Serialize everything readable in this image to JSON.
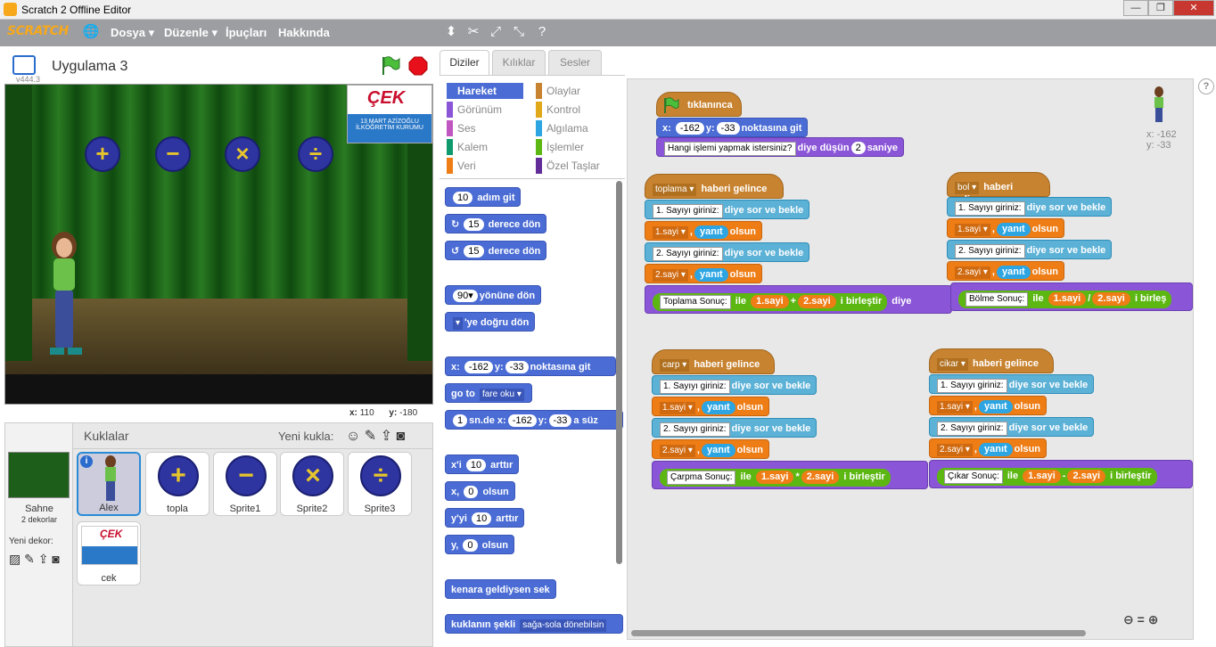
{
  "window": {
    "title": "Scratch 2 Offline Editor"
  },
  "menu": {
    "logo": "SCRATCH",
    "items": [
      "Dosya ▾",
      "Düzenle ▾",
      "İpuçları",
      "Hakkında"
    ]
  },
  "stage": {
    "project_name": "Uygulama 3",
    "version": "v444.3",
    "coords": {
      "x_label": "x:",
      "x_value": "110",
      "y_label": "y:",
      "y_value": "-180"
    },
    "logo_caption": "13 MART AZİZOĞLU\nİLKÖĞRETİM KURUMU"
  },
  "tabs": [
    "Diziler",
    "Kılıklar",
    "Sesler"
  ],
  "categories": {
    "left": [
      "Hareket",
      "Görünüm",
      "Ses",
      "Kalem",
      "Veri"
    ],
    "right": [
      "Olaylar",
      "Kontrol",
      "Algılama",
      "İşlemler",
      "Özel Taşlar"
    ],
    "colors_left": [
      "#4a6cd4",
      "#8a55d7",
      "#c057c0",
      "#0e9a6c",
      "#ee7d16"
    ],
    "colors_right": [
      "#c88330",
      "#e1a91a",
      "#2ca5e2",
      "#5cb712",
      "#632d99"
    ]
  },
  "palette": {
    "b1": {
      "val": "10",
      "txt": "adım git"
    },
    "b2": {
      "val": "15",
      "txt": "derece dön"
    },
    "b3": {
      "val": "15",
      "txt": "derece dön"
    },
    "b4": {
      "val": "90▾",
      "txt": "yönüne dön"
    },
    "b5": {
      "val": "▾",
      "txt": "'ye doğru dön"
    },
    "b6": {
      "x": "x:",
      "xv": "-162",
      "y": "y:",
      "yv": "-33",
      "txt": "noktasına git"
    },
    "b7": {
      "a": "go to",
      "v": "fare oku ▾"
    },
    "b8": {
      "v1": "1",
      "a": "sn.de x:",
      "v2": "-162",
      "b": "y:",
      "v3": "-33",
      "c": "a süz"
    },
    "b9": {
      "a": "x'i",
      "v": "10",
      "b": "arttır"
    },
    "b10": {
      "a": "x,",
      "v": "0",
      "b": "olsun"
    },
    "b11": {
      "a": "y'yi",
      "v": "10",
      "b": "arttır"
    },
    "b12": {
      "a": "y,",
      "v": "0",
      "b": "olsun"
    },
    "b13": {
      "a": "kenara geldiysen sek"
    },
    "b14": {
      "a": "kuklanın şekli",
      "v": "sağa-sola dönebilsin"
    }
  },
  "scripts": {
    "main": {
      "hat": "tıklanınca",
      "goto": {
        "a": "x:",
        "x": "-162",
        "b": "y:",
        "y": "-33",
        "c": "noktasına git"
      },
      "think": {
        "v": "Hangi işlemi yapmak istersiniz?",
        "a": "diye düşün",
        "n": "2",
        "b": "saniye"
      }
    },
    "toplama": {
      "hat_val": "toplama ▾",
      "hat": "haberi gelince",
      "ask1": {
        "v": "1. Sayıyı giriniz:",
        "a": "diye sor ve bekle"
      },
      "set1": {
        "var": "1.sayi ▾",
        "sep": ",",
        "r": "yanıt",
        "a": "olsun"
      },
      "ask2": {
        "v": "2. Sayıyı giriniz:",
        "a": "diye sor ve bekle"
      },
      "set2": {
        "var": "2.sayi ▾",
        "sep": ",",
        "r": "yanıt",
        "a": "olsun"
      },
      "say": {
        "v": "Toplama Sonuç:",
        "a": "ile",
        "n1": "1.sayi",
        "op": "+",
        "n2": "2.sayi",
        "b": "i birleştir",
        "c": "diye"
      }
    },
    "bol": {
      "hat_val": "bol ▾",
      "hat": "haberi gelince",
      "ask1": {
        "v": "1. Sayıyı giriniz:",
        "a": "diye sor ve bekle"
      },
      "set1": {
        "var": "1.sayi ▾",
        "sep": ",",
        "r": "yanıt",
        "a": "olsun"
      },
      "ask2": {
        "v": "2. Sayıyı giriniz:",
        "a": "diye sor ve bekle"
      },
      "set2": {
        "var": "2.sayi ▾",
        "sep": ",",
        "r": "yanıt",
        "a": "olsun"
      },
      "say": {
        "v": "Bölme Sonuç:",
        "a": "ile",
        "n1": "1.sayi",
        "op": "/",
        "n2": "2.sayi",
        "b": "i birleş"
      }
    },
    "carp": {
      "hat_val": "carp ▾",
      "hat": "haberi gelince",
      "ask1": {
        "v": "1. Sayıyı giriniz:",
        "a": "diye sor ve bekle"
      },
      "set1": {
        "var": "1.sayi ▾",
        "sep": ",",
        "r": "yanıt",
        "a": "olsun"
      },
      "ask2": {
        "v": "2. Sayıyı giriniz:",
        "a": "diye sor ve bekle"
      },
      "set2": {
        "var": "2.sayi ▾",
        "sep": ",",
        "r": "yanıt",
        "a": "olsun"
      },
      "say": {
        "v": "Çarpma Sonuç:",
        "a": "ile",
        "n1": "1.sayi",
        "op": "*",
        "n2": "2.sayi",
        "b": "i birleştir"
      }
    },
    "cikar": {
      "hat_val": "cikar ▾",
      "hat": "haberi gelince",
      "ask1": {
        "v": "1. Sayıyı giriniz:",
        "a": "diye sor ve bekle"
      },
      "set1": {
        "var": "1.sayi ▾",
        "sep": ",",
        "r": "yanıt",
        "a": "olsun"
      },
      "ask2": {
        "v": "2. Sayıyı giriniz:",
        "a": "diye sor ve bekle"
      },
      "set2": {
        "var": "2.sayi ▾",
        "sep": ",",
        "r": "yanıt",
        "a": "olsun"
      },
      "say": {
        "v": "Çıkar Sonuç:",
        "a": "ile",
        "n1": "1.sayi",
        "op": "-",
        "n2": "2.sayi",
        "b": "i birleştir"
      }
    }
  },
  "sprite_info": {
    "x": "x: -162",
    "y": "y: -33"
  },
  "sprites_panel": {
    "title": "Kuklalar",
    "new_sprite": "Yeni kukla:",
    "stage_label": "Sahne",
    "stage_sub": "2 dekorlar",
    "new_backdrop": "Yeni dekor:",
    "sprites": [
      "Alex",
      "topla",
      "Sprite1",
      "Sprite2",
      "Sprite3",
      "cek"
    ]
  },
  "logo_text": "ÇEK"
}
